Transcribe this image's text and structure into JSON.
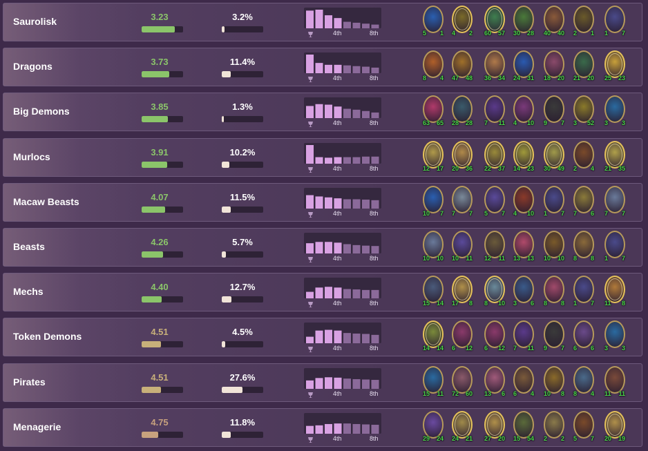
{
  "colors": {
    "avg_green": "#8bc56a",
    "avg_tan": "#c8b07a",
    "avg_dark_tan": "#c8a27e",
    "hist_bar_top": "#d9a2e3",
    "hist_bar_mid": "#b67ac6",
    "hist_bar_low": "#7c5a88"
  },
  "histogram_labels": {
    "fourth": "4th",
    "eighth": "8th"
  },
  "rows": [
    {
      "name": "Saurolisk",
      "avg_place": "3.23",
      "avg_place_value": 3.23,
      "avg_color": "#8bc56a",
      "pick_rate": "3.2%",
      "pick_rate_value": 3.2,
      "placement_distribution": [
        0.95,
        1.0,
        0.7,
        0.55,
        0.35,
        0.3,
        0.25,
        0.2
      ],
      "minions": [
        {
          "icon": "minion-portrait-icon",
          "gold": false,
          "atk": "5",
          "hp": "1",
          "color": "#2a5fb0"
        },
        {
          "icon": "minion-portrait-icon",
          "gold": true,
          "atk": "4",
          "hp": "2",
          "color": "#7a6a2a"
        },
        {
          "icon": "minion-portrait-icon",
          "gold": true,
          "atk": "60",
          "hp": "57",
          "color": "#3f7f4f"
        },
        {
          "icon": "minion-portrait-icon",
          "gold": false,
          "atk": "30",
          "hp": "28",
          "color": "#4a7a3a"
        },
        {
          "icon": "minion-portrait-icon",
          "gold": false,
          "atk": "40",
          "hp": "40",
          "color": "#8a5a3a"
        },
        {
          "icon": "minion-portrait-icon",
          "gold": false,
          "atk": "2",
          "hp": "1",
          "color": "#6a5a2a"
        },
        {
          "icon": "minion-portrait-icon",
          "gold": false,
          "atk": "1",
          "hp": "7",
          "color": "#4a4a8a"
        }
      ]
    },
    {
      "name": "Dragons",
      "avg_place": "3.73",
      "avg_place_value": 3.73,
      "avg_color": "#8bc56a",
      "pick_rate": "11.4%",
      "pick_rate_value": 11.4,
      "placement_distribution": [
        1.0,
        0.55,
        0.45,
        0.45,
        0.42,
        0.38,
        0.35,
        0.3
      ],
      "minions": [
        {
          "icon": "minion-portrait-icon",
          "gold": false,
          "atk": "8",
          "hp": "4",
          "color": "#b0602a"
        },
        {
          "icon": "minion-portrait-icon",
          "gold": false,
          "atk": "47",
          "hp": "48",
          "color": "#a0702a"
        },
        {
          "icon": "minion-portrait-icon",
          "gold": false,
          "atk": "36",
          "hp": "34",
          "color": "#b07a4a"
        },
        {
          "icon": "minion-portrait-icon",
          "gold": false,
          "atk": "24",
          "hp": "31",
          "color": "#2a5ab0"
        },
        {
          "icon": "minion-portrait-icon",
          "gold": false,
          "atk": "18",
          "hp": "20",
          "color": "#8a4a6a"
        },
        {
          "icon": "minion-portrait-icon",
          "gold": false,
          "atk": "21",
          "hp": "20",
          "color": "#3a6a4a"
        },
        {
          "icon": "minion-portrait-icon",
          "gold": true,
          "atk": "25",
          "hp": "23",
          "color": "#c8a03a"
        }
      ]
    },
    {
      "name": "Big Demons",
      "avg_place": "3.85",
      "avg_place_value": 3.85,
      "avg_color": "#8bc56a",
      "pick_rate": "1.3%",
      "pick_rate_value": 1.3,
      "placement_distribution": [
        0.65,
        0.75,
        0.72,
        0.62,
        0.5,
        0.45,
        0.38,
        0.3
      ],
      "minions": [
        {
          "icon": "minion-portrait-icon",
          "gold": false,
          "atk": "63",
          "hp": "65",
          "color": "#b03a6a"
        },
        {
          "icon": "minion-portrait-icon",
          "gold": false,
          "atk": "28",
          "hp": "28",
          "color": "#3a5a6a"
        },
        {
          "icon": "minion-portrait-icon",
          "gold": false,
          "atk": "7",
          "hp": "11",
          "color": "#5a3a8a"
        },
        {
          "icon": "minion-portrait-icon",
          "gold": false,
          "atk": "4",
          "hp": "10",
          "color": "#7a3a7a"
        },
        {
          "icon": "minion-portrait-icon",
          "gold": false,
          "atk": "9",
          "hp": "7",
          "color": "#3a3a3a"
        },
        {
          "icon": "minion-portrait-icon",
          "gold": false,
          "atk": "3",
          "hp": "52",
          "color": "#8a7a2a"
        },
        {
          "icon": "minion-portrait-icon",
          "gold": false,
          "atk": "3",
          "hp": "3",
          "color": "#2a6aa0"
        }
      ]
    },
    {
      "name": "Murlocs",
      "avg_place": "3.91",
      "avg_place_value": 3.91,
      "avg_color": "#8bc56a",
      "pick_rate": "10.2%",
      "pick_rate_value": 10.2,
      "placement_distribution": [
        1.0,
        0.35,
        0.32,
        0.35,
        0.35,
        0.35,
        0.38,
        0.38
      ],
      "minions": [
        {
          "icon": "minion-portrait-icon",
          "gold": true,
          "atk": "12",
          "hp": "17",
          "color": "#b09a4a"
        },
        {
          "icon": "minion-portrait-icon",
          "gold": true,
          "atk": "20",
          "hp": "36",
          "color": "#b08a4a"
        },
        {
          "icon": "minion-portrait-icon",
          "gold": true,
          "atk": "22",
          "hp": "37",
          "color": "#9a8a3a"
        },
        {
          "icon": "minion-portrait-icon",
          "gold": true,
          "atk": "14",
          "hp": "23",
          "color": "#a09a3a"
        },
        {
          "icon": "minion-portrait-icon",
          "gold": true,
          "atk": "30",
          "hp": "49",
          "color": "#a09a4a"
        },
        {
          "icon": "minion-portrait-icon",
          "gold": false,
          "atk": "2",
          "hp": "4",
          "color": "#7a4a2a"
        },
        {
          "icon": "minion-portrait-icon",
          "gold": true,
          "atk": "21",
          "hp": "35",
          "color": "#b0a04a"
        }
      ]
    },
    {
      "name": "Macaw Beasts",
      "avg_place": "4.07",
      "avg_place_value": 4.07,
      "avg_color": "#8bc56a",
      "pick_rate": "11.5%",
      "pick_rate_value": 11.5,
      "placement_distribution": [
        0.72,
        0.65,
        0.6,
        0.55,
        0.5,
        0.5,
        0.48,
        0.45
      ],
      "minions": [
        {
          "icon": "minion-portrait-icon",
          "gold": false,
          "atk": "10",
          "hp": "7",
          "color": "#2a5fb0"
        },
        {
          "icon": "minion-portrait-icon",
          "gold": false,
          "atk": "7",
          "hp": "7",
          "color": "#7a8a9a"
        },
        {
          "icon": "minion-portrait-icon",
          "gold": false,
          "atk": "5",
          "hp": "7",
          "color": "#5a4a9a"
        },
        {
          "icon": "minion-portrait-icon",
          "gold": false,
          "atk": "4",
          "hp": "10",
          "color": "#8a3a2a"
        },
        {
          "icon": "minion-portrait-icon",
          "gold": false,
          "atk": "1",
          "hp": "7",
          "color": "#4a4a8a"
        },
        {
          "icon": "minion-portrait-icon",
          "gold": false,
          "atk": "7",
          "hp": "6",
          "color": "#8a7a3a"
        },
        {
          "icon": "minion-portrait-icon",
          "gold": false,
          "atk": "7",
          "hp": "7",
          "color": "#6a7a9a"
        }
      ]
    },
    {
      "name": "Beasts",
      "avg_place": "4.26",
      "avg_place_value": 4.26,
      "avg_color": "#8bc56a",
      "pick_rate": "5.7%",
      "pick_rate_value": 5.7,
      "placement_distribution": [
        0.55,
        0.62,
        0.62,
        0.58,
        0.5,
        0.45,
        0.42,
        0.4
      ],
      "minions": [
        {
          "icon": "minion-portrait-icon",
          "gold": false,
          "atk": "10",
          "hp": "10",
          "color": "#6a7a9a"
        },
        {
          "icon": "minion-portrait-icon",
          "gold": false,
          "atk": "10",
          "hp": "11",
          "color": "#5a4a9a"
        },
        {
          "icon": "minion-portrait-icon",
          "gold": false,
          "atk": "12",
          "hp": "11",
          "color": "#6a5a3a"
        },
        {
          "icon": "minion-portrait-icon",
          "gold": false,
          "atk": "13",
          "hp": "13",
          "color": "#b04a6a"
        },
        {
          "icon": "minion-portrait-icon",
          "gold": false,
          "atk": "10",
          "hp": "10",
          "color": "#7a5a2a"
        },
        {
          "icon": "minion-portrait-icon",
          "gold": false,
          "atk": "8",
          "hp": "8",
          "color": "#8a6a3a"
        },
        {
          "icon": "minion-portrait-icon",
          "gold": false,
          "atk": "1",
          "hp": "7",
          "color": "#4a4a8a"
        }
      ]
    },
    {
      "name": "Mechs",
      "avg_place": "4.40",
      "avg_place_value": 4.4,
      "avg_color": "#8bc56a",
      "pick_rate": "12.7%",
      "pick_rate_value": 12.7,
      "placement_distribution": [
        0.35,
        0.58,
        0.62,
        0.58,
        0.5,
        0.48,
        0.45,
        0.45
      ],
      "minions": [
        {
          "icon": "minion-portrait-icon",
          "gold": false,
          "atk": "15",
          "hp": "14",
          "color": "#4a5a7a"
        },
        {
          "icon": "minion-portrait-icon",
          "gold": true,
          "atk": "17",
          "hp": "8",
          "color": "#b0904a"
        },
        {
          "icon": "minion-portrait-icon",
          "gold": true,
          "atk": "8",
          "hp": "10",
          "color": "#6a8a9a"
        },
        {
          "icon": "minion-portrait-icon",
          "gold": false,
          "atk": "3",
          "hp": "6",
          "color": "#3a5a8a"
        },
        {
          "icon": "minion-portrait-icon",
          "gold": false,
          "atk": "8",
          "hp": "8",
          "color": "#a04a6a"
        },
        {
          "icon": "minion-portrait-icon",
          "gold": false,
          "atk": "1",
          "hp": "7",
          "color": "#4a4a8a"
        },
        {
          "icon": "minion-portrait-icon",
          "gold": true,
          "atk": "11",
          "hp": "8",
          "color": "#b07a3a"
        }
      ]
    },
    {
      "name": "Token Demons",
      "avg_place": "4.51",
      "avg_place_value": 4.51,
      "avg_color": "#c8b07a",
      "pick_rate": "4.5%",
      "pick_rate_value": 4.5,
      "placement_distribution": [
        0.35,
        0.68,
        0.72,
        0.68,
        0.55,
        0.52,
        0.5,
        0.45
      ],
      "minions": [
        {
          "icon": "minion-portrait-icon",
          "gold": true,
          "atk": "14",
          "hp": "14",
          "color": "#7a8a3a"
        },
        {
          "icon": "minion-portrait-icon",
          "gold": false,
          "atk": "6",
          "hp": "12",
          "color": "#8a3a6a"
        },
        {
          "icon": "minion-portrait-icon",
          "gold": false,
          "atk": "6",
          "hp": "12",
          "color": "#8a3a6a"
        },
        {
          "icon": "minion-portrait-icon",
          "gold": false,
          "atk": "7",
          "hp": "11",
          "color": "#5a3a8a"
        },
        {
          "icon": "minion-portrait-icon",
          "gold": false,
          "atk": "9",
          "hp": "7",
          "color": "#3a3a3a"
        },
        {
          "icon": "minion-portrait-icon",
          "gold": false,
          "atk": "6",
          "hp": "6",
          "color": "#6a4a8a"
        },
        {
          "icon": "minion-portrait-icon",
          "gold": false,
          "atk": "3",
          "hp": "3",
          "color": "#2a6aa0"
        }
      ]
    },
    {
      "name": "Pirates",
      "avg_place": "4.51",
      "avg_place_value": 4.51,
      "avg_color": "#c8b07a",
      "pick_rate": "27.6%",
      "pick_rate_value": 27.6,
      "placement_distribution": [
        0.45,
        0.58,
        0.62,
        0.6,
        0.55,
        0.52,
        0.5,
        0.48
      ],
      "minions": [
        {
          "icon": "minion-portrait-icon",
          "gold": false,
          "atk": "15",
          "hp": "11",
          "color": "#2a6aa0"
        },
        {
          "icon": "minion-portrait-icon",
          "gold": false,
          "atk": "72",
          "hp": "60",
          "color": "#8a5a6a"
        },
        {
          "icon": "minion-portrait-icon",
          "gold": false,
          "atk": "13",
          "hp": "6",
          "color": "#a05a7a"
        },
        {
          "icon": "minion-portrait-icon",
          "gold": false,
          "atk": "6",
          "hp": "4",
          "color": "#7a5a3a"
        },
        {
          "icon": "minion-portrait-icon",
          "gold": false,
          "atk": "10",
          "hp": "8",
          "color": "#8a6a2a"
        },
        {
          "icon": "minion-portrait-icon",
          "gold": false,
          "atk": "8",
          "hp": "4",
          "color": "#4a6a8a"
        },
        {
          "icon": "minion-portrait-icon",
          "gold": false,
          "atk": "11",
          "hp": "11",
          "color": "#7a4a3a"
        }
      ]
    },
    {
      "name": "Menagerie",
      "avg_place": "4.75",
      "avg_place_value": 4.75,
      "avg_color": "#c8a27e",
      "pick_rate": "11.8%",
      "pick_rate_value": 11.8,
      "placement_distribution": [
        0.42,
        0.45,
        0.52,
        0.55,
        0.55,
        0.52,
        0.5,
        0.48
      ],
      "minions": [
        {
          "icon": "minion-portrait-icon",
          "gold": false,
          "atk": "29",
          "hp": "24",
          "color": "#6a4aa0"
        },
        {
          "icon": "minion-portrait-icon",
          "gold": true,
          "atk": "24",
          "hp": "21",
          "color": "#a08a4a"
        },
        {
          "icon": "minion-portrait-icon",
          "gold": true,
          "atk": "27",
          "hp": "20",
          "color": "#b0904a"
        },
        {
          "icon": "minion-portrait-icon",
          "gold": false,
          "atk": "15",
          "hp": "54",
          "color": "#5a6a3a"
        },
        {
          "icon": "minion-portrait-icon",
          "gold": false,
          "atk": "2",
          "hp": "2",
          "color": "#8a7a4a"
        },
        {
          "icon": "minion-portrait-icon",
          "gold": false,
          "atk": "5",
          "hp": "7",
          "color": "#7a4a2a"
        },
        {
          "icon": "minion-portrait-icon",
          "gold": true,
          "atk": "20",
          "hp": "19",
          "color": "#b0904a"
        }
      ]
    }
  ]
}
